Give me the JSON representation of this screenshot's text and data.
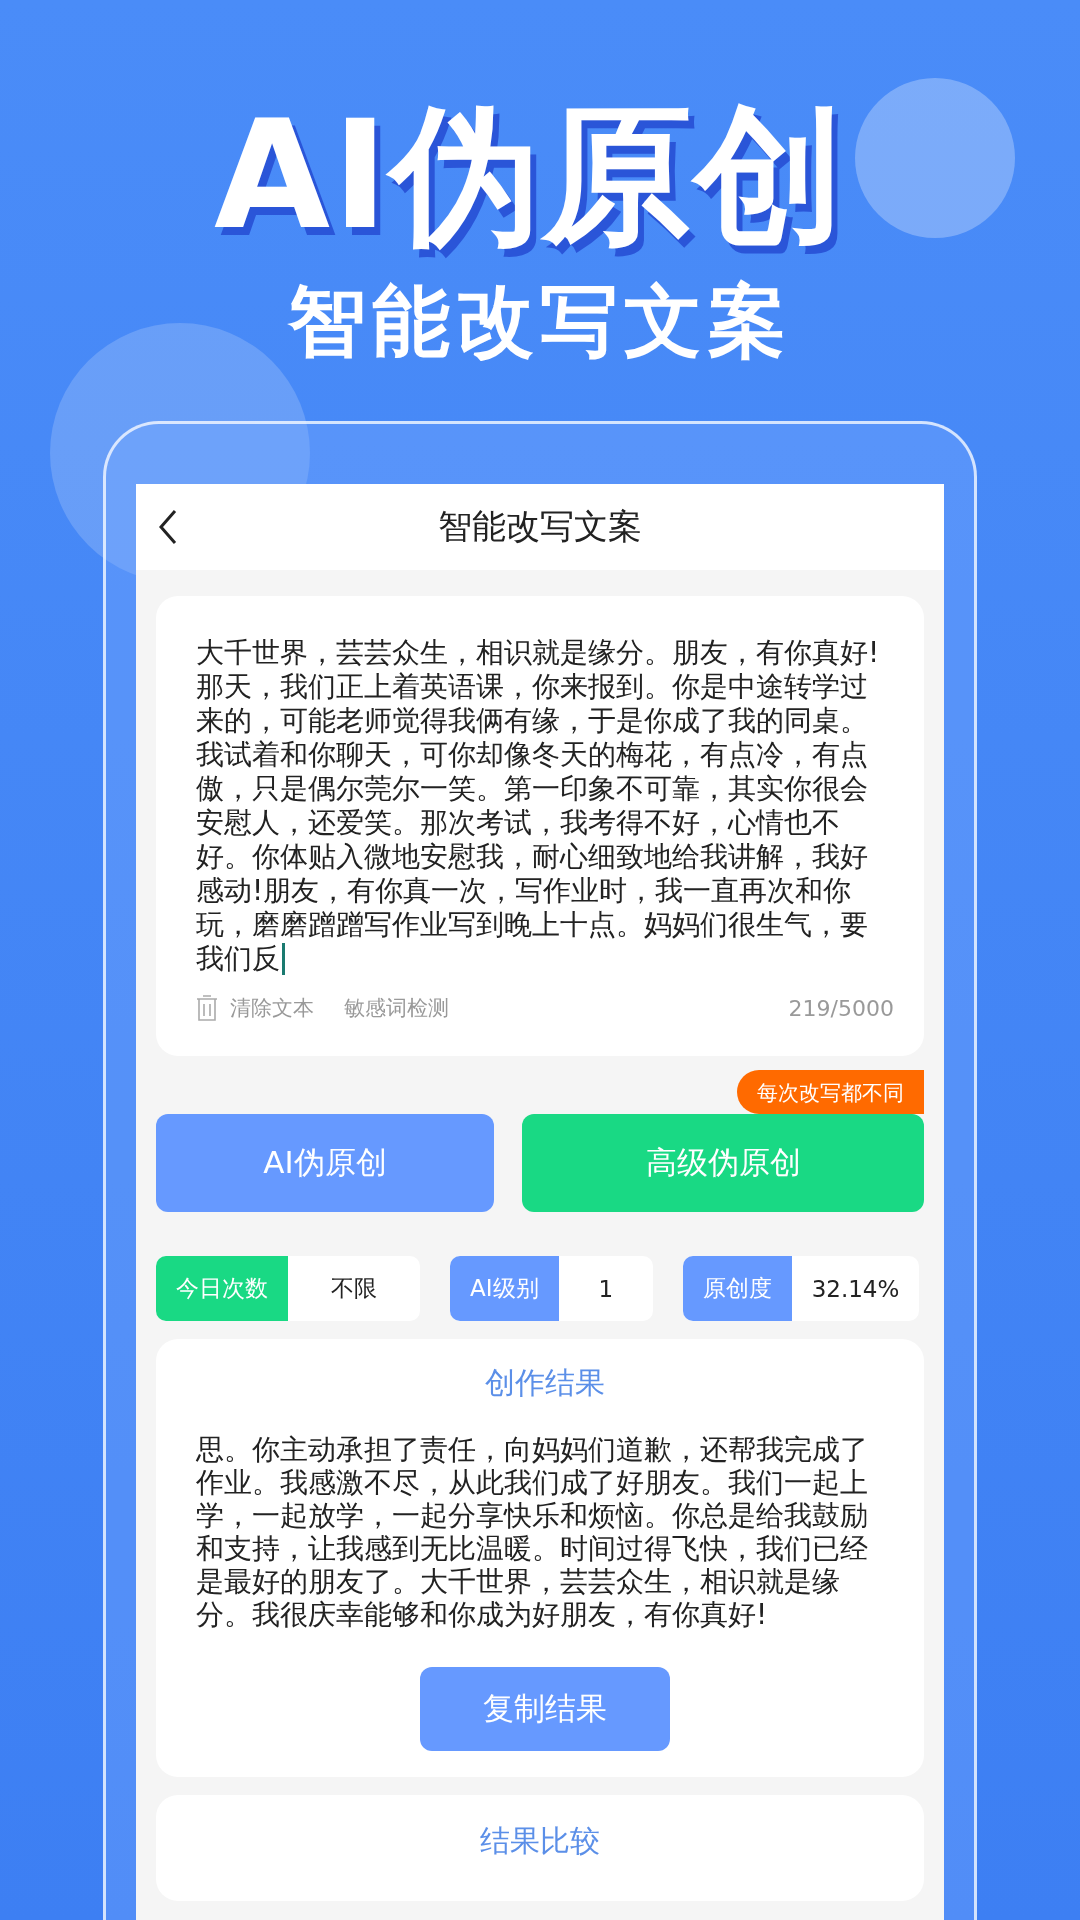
{
  "hero": {
    "title": "AI伪原创",
    "subtitle": "智能改写文案"
  },
  "screen": {
    "title": "智能改写文案",
    "input": {
      "lines": [
        "大千世界，芸芸众生，相识就是缘分。朋友，有你真好!",
        "那天，我们正上着英语课，你来报到。你是中途转学过",
        "来的，可能老师觉得我俩有缘，于是你成了我的同桌。",
        "我试着和你聊天，可你却像冬天的梅花，有点冷，有点",
        "傲，只是偶尔莞尔一笑。第一印象不可靠，其实你很会",
        "安慰人，还爱笑。那次考试，我考得不好，心情也不",
        "好。你体贴入微地安慰我，耐心细致地给我讲解，我好",
        "感动!朋友，有你真一次，写作业时，我一直再次和你",
        "玩，磨磨蹭蹭写作业写到晚上十点。妈妈们很生气，要",
        "我们反"
      ],
      "actions": [
        {
          "label": "清除文本",
          "kind": "clear"
        },
        {
          "label": "敏感词检测",
          "kind": "check"
        }
      ],
      "count": "219/5000"
    },
    "buttons": [
      {
        "label": "AI伪原创",
        "kind": "primary"
      },
      {
        "label": "高级伪原创",
        "kind": "premium",
        "badge": "每次改写都不同"
      }
    ],
    "stats": [
      {
        "label": "今日次数",
        "value": "不限",
        "color": "#19d984"
      },
      {
        "label": "AI级别",
        "value": "1",
        "color": "#6699ff"
      },
      {
        "label": "原创度",
        "value": "32.14%",
        "color": "#6699ff"
      }
    ],
    "result": {
      "title": "创作结果",
      "lines": [
        "思。你主动承担了责任，向妈妈们道歉，还帮我完成了",
        "作业。我感激不尽，从此我们成了好朋友。我们一起上",
        "学，一起放学，一起分享快乐和烦恼。你总是给我鼓励",
        "和支持，让我感到无比温暖。时间过得飞快，我们已经",
        "是最好的朋友了。大千世界，芸芸众生，相识就是缘",
        "分。我很庆幸能够和你成为好朋友，有你真好!"
      ],
      "button": "复制结果"
    },
    "compare": {
      "title": "结果比较"
    }
  }
}
